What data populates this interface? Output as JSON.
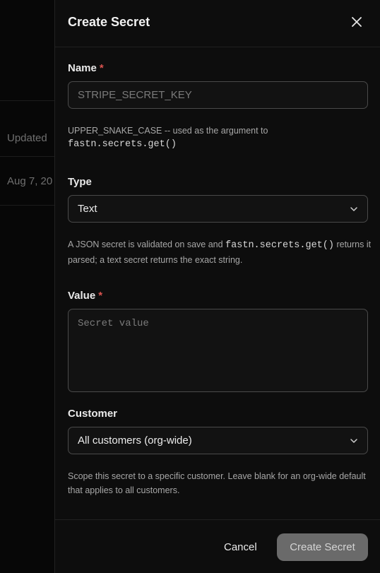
{
  "background": {
    "column_header": "Updated",
    "cell_value": "Aug 7, 20"
  },
  "dialog": {
    "title": "Create Secret",
    "close_icon": "close-icon"
  },
  "fields": {
    "name": {
      "label": "Name",
      "required_mark": "*",
      "placeholder": "STRIPE_SECRET_KEY",
      "value": "",
      "help_line1": "UPPER_SNAKE_CASE -- used as the argument to",
      "help_code": "fastn.secrets.get()"
    },
    "type": {
      "label": "Type",
      "value": "Text",
      "help_before": "A JSON secret is validated on save and ",
      "help_code": "fastn.secrets.get()",
      "help_after": " returns it parsed; a text secret returns the exact string."
    },
    "value": {
      "label": "Value",
      "required_mark": "*",
      "placeholder": "Secret value",
      "value": ""
    },
    "customer": {
      "label": "Customer",
      "value": "All customers (org-wide)",
      "help": "Scope this secret to a specific customer. Leave blank for an org-wide default that applies to all customers."
    }
  },
  "footer": {
    "cancel_label": "Cancel",
    "create_label": "Create Secret"
  },
  "colors": {
    "required": "#d9534f",
    "primary_disabled": "#6a6a6a",
    "panel_bg": "#0d0d0d"
  }
}
